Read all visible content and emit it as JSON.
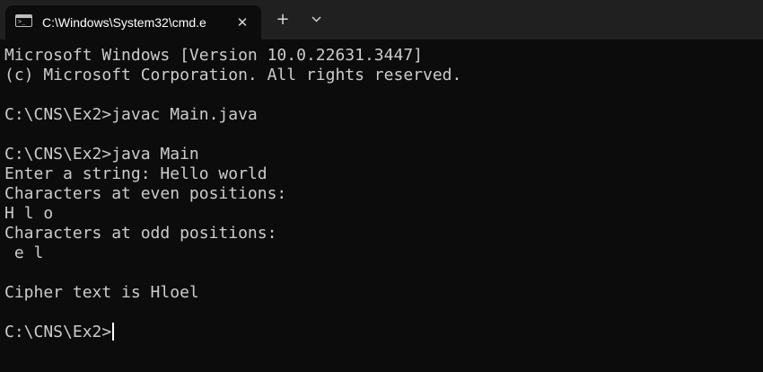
{
  "tab": {
    "title": "C:\\Windows\\System32\\cmd.e",
    "icon": "command-prompt-icon",
    "close_icon": "close-icon"
  },
  "toolbar": {
    "new_tab_icon": "plus-icon",
    "dropdown_icon": "chevron-down-icon"
  },
  "console": {
    "lines": [
      "Microsoft Windows [Version 10.0.22631.3447]",
      "(c) Microsoft Corporation. All rights reserved.",
      "",
      "C:\\CNS\\Ex2>javac Main.java",
      "",
      "C:\\CNS\\Ex2>java Main",
      "Enter a string: Hello world",
      "Characters at even positions:",
      "H l o",
      "Characters at odd positions:",
      " e l",
      "",
      "Cipher text is Hloel",
      ""
    ],
    "prompt": "C:\\CNS\\Ex2>"
  },
  "colors": {
    "background": "#0c0c0c",
    "tabbar": "#202020",
    "text": "#cccccc"
  }
}
